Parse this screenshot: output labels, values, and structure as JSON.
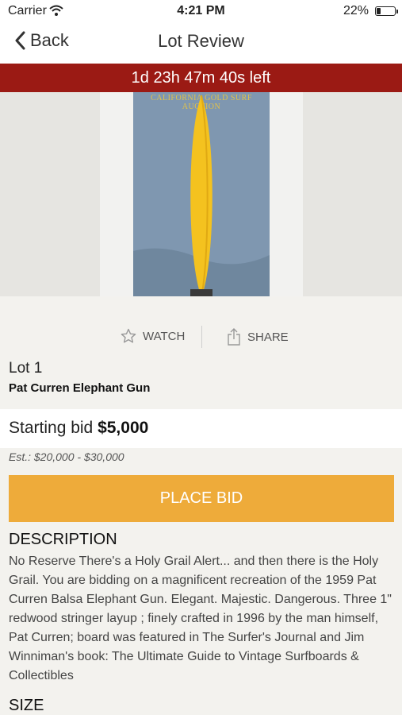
{
  "status_bar": {
    "carrier": "Carrier",
    "time": "4:21 PM",
    "battery_percent": "22%",
    "battery_level": 0.22
  },
  "nav": {
    "back_label": "Back",
    "title": "Lot Review"
  },
  "timer": {
    "text": "1d 23h 47m 40s left",
    "color": "#9b1a14"
  },
  "image": {
    "watermark_text": "CALIFORNIA GOLD SURF AUCTION"
  },
  "actions": {
    "watch_label": "WATCH",
    "share_label": "SHARE"
  },
  "lot": {
    "number": "Lot 1",
    "title": "Pat Curren Elephant Gun"
  },
  "bid": {
    "label": "Starting bid",
    "amount": "$5,000",
    "estimate": "Est.: $20,000 - $30,000",
    "place_bid_label": "PLACE BID",
    "accent_color": "#eeab3a"
  },
  "description": {
    "heading": "DESCRIPTION",
    "text": "No Reserve There's a Holy Grail Alert... and then there is the Holy Grail. You are bidding on a magnificent recreation of the 1959 Pat Curren Balsa Elephant Gun. Elegant. Majestic. Dangerous. Three 1\" redwood stringer layup ; finely crafted in 1996 by the man himself, Pat Curren; board was featured in The Surfer's Journal and Jim Winniman's book: The Ultimate Guide to Vintage Surfboards & Collectibles"
  },
  "size": {
    "heading": "SIZE"
  }
}
